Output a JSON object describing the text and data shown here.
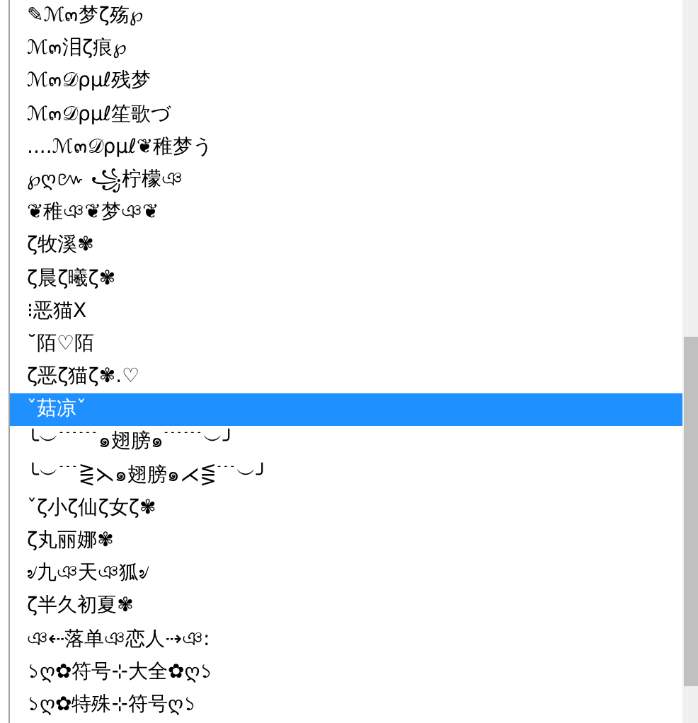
{
  "dropdown_list": {
    "items": [
      {
        "label": "✎ℳ๓梦ζ殇℘",
        "selected": false
      },
      {
        "label": "ℳ๓泪ζ痕℘",
        "selected": false
      },
      {
        "label": "ℳ๓𝒟ρμℓ残梦",
        "selected": false
      },
      {
        "label": "ℳ๓𝒟ρμℓ笙歌づ",
        "selected": false
      },
      {
        "label": "....ℳ๓𝒟ρμℓ❦稚梦う",
        "selected": false
      },
      {
        "label": "℘ღ៚ ꧁柠檬ঞ",
        "selected": false
      },
      {
        "label": "❦稚ঞ❦梦ঞ❦",
        "selected": false
      },
      {
        "label": "ζ牧溪✾",
        "selected": false
      },
      {
        "label": "ζ晨ζ曦ζ✾",
        "selected": false
      },
      {
        "label": "⁝恶猫Ⅹ",
        "selected": false
      },
      {
        "label": "˘陌♡陌",
        "selected": false
      },
      {
        "label": "ζ恶ζ猫ζ✾.♡",
        "selected": false
      },
      {
        "label": "ˇ菇凉ˇ",
        "selected": true
      },
      {
        "label": "╰︶﹉﹉๑翅膀๑﹉﹉︶╯",
        "selected": false
      },
      {
        "label": "╰︶﹉⋛⋋๑翅膀๑⋌⋚﹉︶╯",
        "selected": false
      },
      {
        "label": "ˇζ小ζ仙ζ女ζ✾",
        "selected": false
      },
      {
        "label": "ζ丸丽娜✾",
        "selected": false
      },
      {
        "label": "৶九ঞ天ঞ狐৶",
        "selected": false
      },
      {
        "label": "ζ半久初夏✾",
        "selected": false
      },
      {
        "label": "ঞ⇠落单ঞ恋人⇢ঞ:",
        "selected": false
      },
      {
        "label": "১ღ✿符号⊹大全✿ღ১",
        "selected": false
      },
      {
        "label": "১ღ✿特殊⊹符号ღ১",
        "selected": false
      }
    ]
  }
}
